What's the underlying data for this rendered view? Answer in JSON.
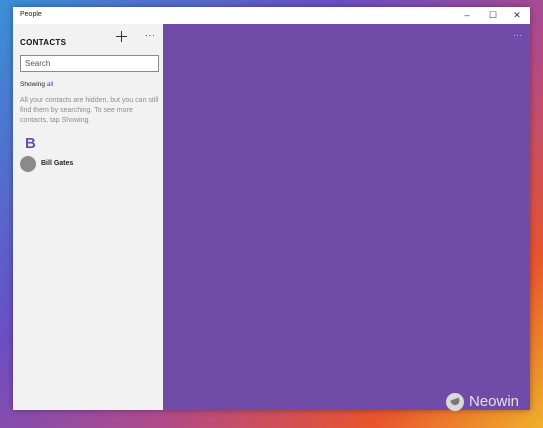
{
  "window": {
    "title": "People",
    "controls": {
      "minimize": "–",
      "maximize": "☐",
      "close": "✕"
    }
  },
  "sidebar": {
    "heading": "CONTACTS",
    "add_icon": "plus-icon",
    "more_label": "···",
    "search_placeholder": "Search",
    "showing_label": "Showing",
    "showing_link": "all",
    "hint": "All your contacts are hidden, but you can still find them by searching. To see more contacts, tap Showing.",
    "group_letter": "B",
    "contacts": [
      {
        "name": "Bill Gates"
      }
    ]
  },
  "main": {
    "more_label": "···",
    "background": "#704ca8"
  },
  "watermark": {
    "text": "Neowin"
  }
}
